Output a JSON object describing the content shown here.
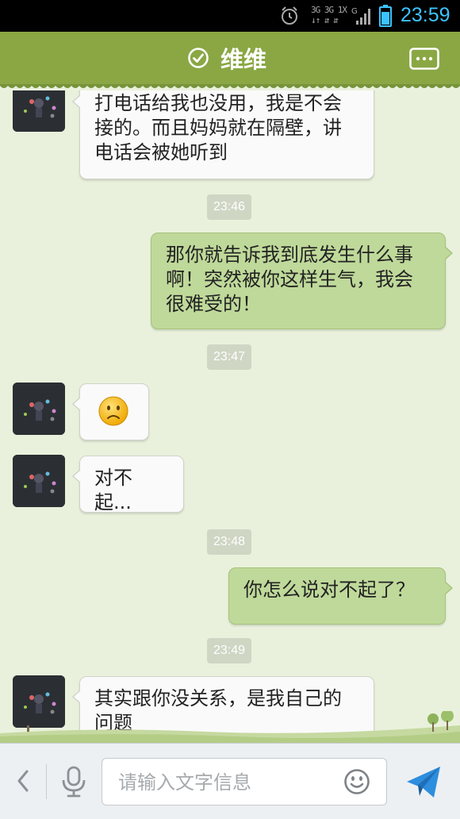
{
  "status_bar": {
    "network_top": "3G 3G 1X",
    "network_bottom": "↓↑ ⇵ ⇵",
    "network_g": "G",
    "time": "23:59",
    "time_color": "#3cc3ff"
  },
  "header": {
    "title": "维维",
    "status_icon": "check-circle-icon",
    "menu_icon": "more-dots-icon",
    "color": "#8aa744"
  },
  "messages": [
    {
      "type": "in",
      "text": "打电话给我也没用，我是不会接的。而且妈妈就在隔壁，讲电话会被她听到"
    },
    {
      "type": "time",
      "text": "23:46"
    },
    {
      "type": "out",
      "text": "那你就告诉我到底发生什么事啊！突然被你这样生气，我会很难受的！"
    },
    {
      "type": "time",
      "text": "23:47"
    },
    {
      "type": "in",
      "emoji": "sad-face-emoji"
    },
    {
      "type": "in",
      "text": "对不起..."
    },
    {
      "type": "time",
      "text": "23:48"
    },
    {
      "type": "out",
      "text": "你怎么说对不起了？"
    },
    {
      "type": "time",
      "text": "23:49"
    },
    {
      "type": "in",
      "text": "其实跟你没关系，是我自己的问题"
    }
  ],
  "input_bar": {
    "placeholder": "请输入文字信息",
    "value": ""
  },
  "colors": {
    "incoming_bubble": "#fafafa",
    "outgoing_bubble": "#bfd99a",
    "background": "#e9f1dc"
  }
}
